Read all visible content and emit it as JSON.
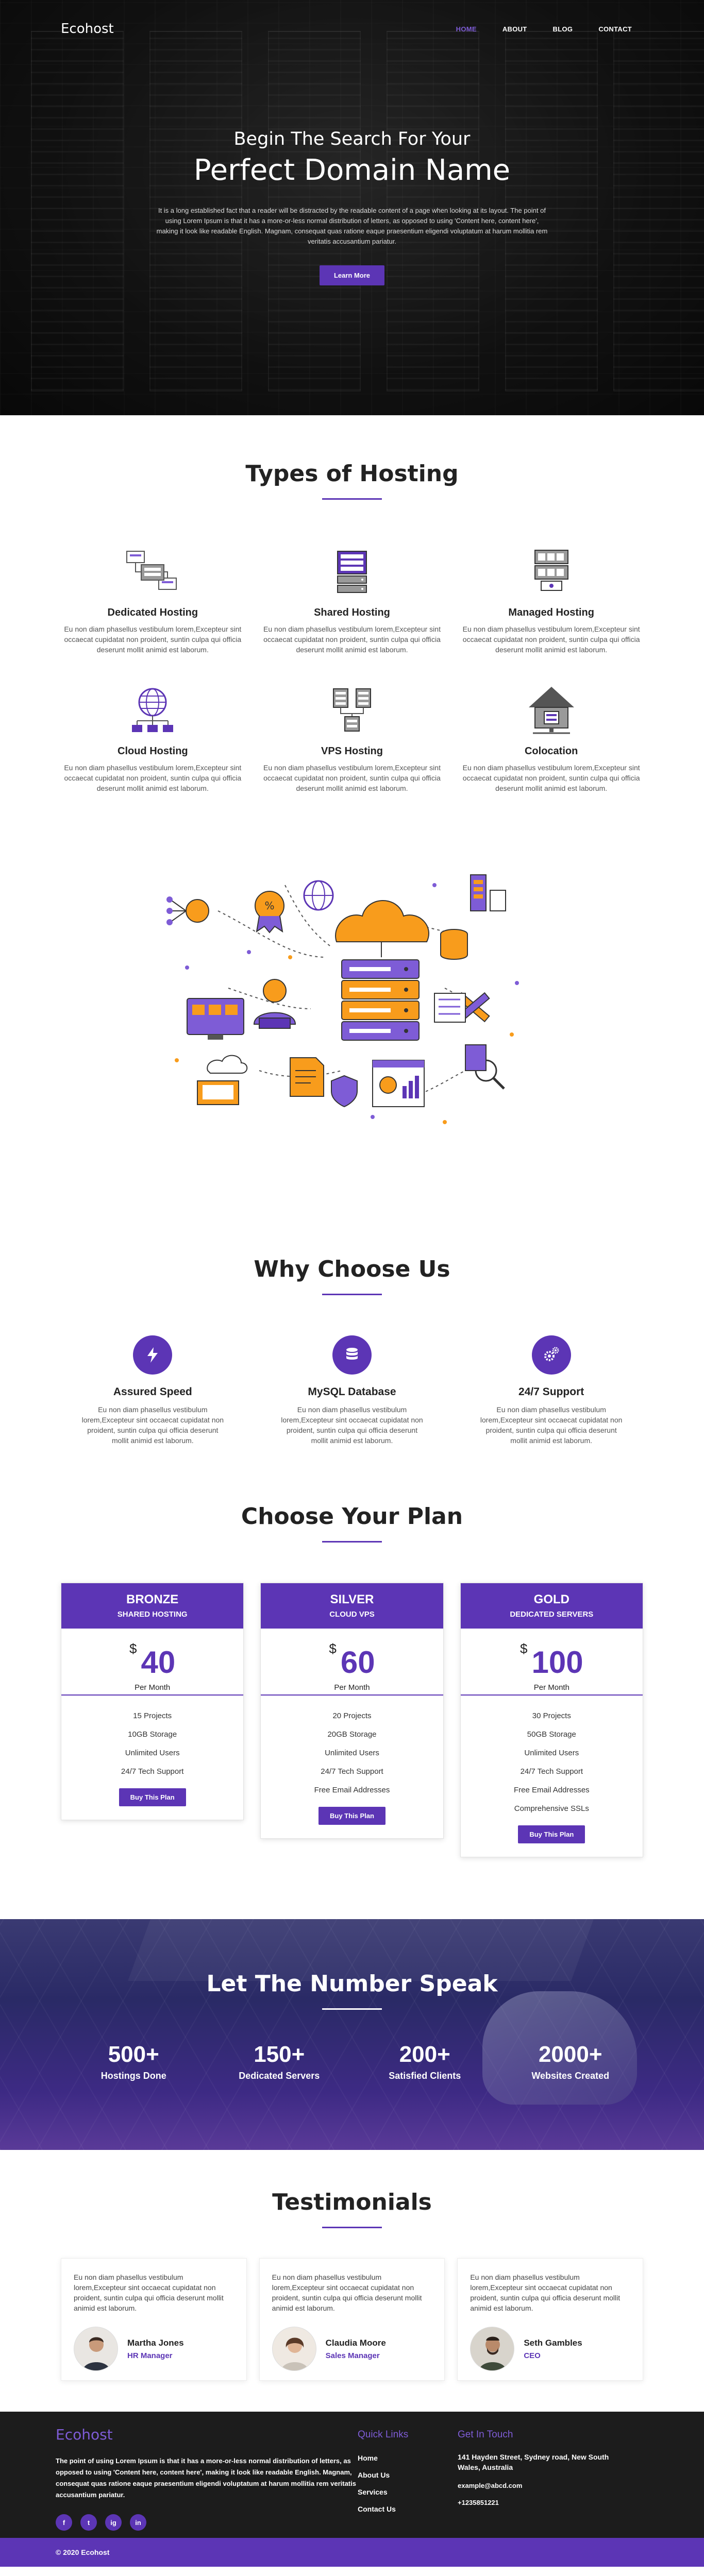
{
  "colors": {
    "accent": "#5c35b5",
    "accent_light": "#7e5cd6",
    "orange": "#f89c1c",
    "dark": "#1c1c1c"
  },
  "nav": {
    "logo": "Ecohost",
    "links": [
      "HOME",
      "ABOUT",
      "BLOG",
      "CONTACT"
    ],
    "active": "HOME"
  },
  "hero": {
    "subtitle": "Begin The Search For Your",
    "title": "Perfect Domain Name",
    "text": "It is a long established fact that a reader will be distracted by the readable content of a page when looking at its layout. The point of using Lorem Ipsum is that it has a more-or-less normal distribution of letters, as opposed to using 'Content here, content here', making it look like readable English. Magnam, consequat quas ratione eaque praesentium eligendi voluptatum at harum mollitia rem veritatis accusantium pariatur.",
    "button": "Learn More"
  },
  "hosting": {
    "title": "Types of Hosting",
    "items": [
      {
        "name": "Dedicated Hosting",
        "icon": "dedicated-server-icon",
        "desc": "Eu non diam phasellus vestibulum lorem,Excepteur sint occaecat cupidatat non proident, suntin culpa qui officia deserunt mollit animid est laborum."
      },
      {
        "name": "Shared Hosting",
        "icon": "shared-server-icon",
        "desc": "Eu non diam phasellus vestibulum lorem,Excepteur sint occaecat cupidatat non proident, suntin culpa qui officia deserunt mollit animid est laborum."
      },
      {
        "name": "Managed Hosting",
        "icon": "managed-server-icon",
        "desc": "Eu non diam phasellus vestibulum lorem,Excepteur sint occaecat cupidatat non proident, suntin culpa qui officia deserunt mollit animid est laborum."
      },
      {
        "name": "Cloud Hosting",
        "icon": "globe-network-icon",
        "desc": "Eu non diam phasellus vestibulum lorem,Excepteur sint occaecat cupidatat non proident, suntin culpa qui officia deserunt mollit animid est laborum."
      },
      {
        "name": "VPS Hosting",
        "icon": "vps-server-icon",
        "desc": "Eu non diam phasellus vestibulum lorem,Excepteur sint occaecat cupidatat non proident, suntin culpa qui officia deserunt mollit animid est laborum."
      },
      {
        "name": "Colocation",
        "icon": "house-server-icon",
        "desc": "Eu non diam phasellus vestibulum lorem,Excepteur sint occaecat cupidatat non proident, suntin culpa qui officia deserunt mollit animid est laborum."
      }
    ]
  },
  "why": {
    "title": "Why Choose Us",
    "items": [
      {
        "name": "Assured Speed",
        "icon": "lightning-icon",
        "desc": "Eu non diam phasellus vestibulum lorem,Excepteur sint occaecat cupidatat non proident, suntin culpa qui officia deserunt mollit animid est laborum."
      },
      {
        "name": "MySQL Database",
        "icon": "database-icon",
        "desc": "Eu non diam phasellus vestibulum lorem,Excepteur sint occaecat cupidatat non proident, suntin culpa qui officia deserunt mollit animid est laborum."
      },
      {
        "name": "24/7 Support",
        "icon": "gears-icon",
        "desc": "Eu non diam phasellus vestibulum lorem,Excepteur sint occaecat cupidatat non proident, suntin culpa qui officia deserunt mollit animid est laborum."
      }
    ]
  },
  "plans": {
    "title": "Choose Your Plan",
    "currency": "$",
    "per": "Per Month",
    "button": "Buy This Plan",
    "items": [
      {
        "name": "BRONZE",
        "type": "SHARED HOSTING",
        "price": "40",
        "features": [
          "15 Projects",
          "10GB Storage",
          "Unlimited Users",
          "24/7 Tech Support"
        ]
      },
      {
        "name": "SILVER",
        "type": "CLOUD VPS",
        "price": "60",
        "features": [
          "20 Projects",
          "20GB Storage",
          "Unlimited Users",
          "24/7 Tech Support",
          "Free Email Addresses"
        ]
      },
      {
        "name": "GOLD",
        "type": "DEDICATED SERVERS",
        "price": "100",
        "features": [
          "30 Projects",
          "50GB Storage",
          "Unlimited Users",
          "24/7 Tech Support",
          "Free Email Addresses",
          "Comprehensive SSLs"
        ]
      }
    ]
  },
  "numbers": {
    "title": "Let The Number Speak",
    "items": [
      {
        "value": "500+",
        "label": "Hostings Done"
      },
      {
        "value": "150+",
        "label": "Dedicated Servers"
      },
      {
        "value": "200+",
        "label": "Satisfied Clients"
      },
      {
        "value": "2000+",
        "label": "Websites Created"
      }
    ]
  },
  "testimonials": {
    "title": "Testimonials",
    "items": [
      {
        "text": "Eu non diam phasellus vestibulum lorem,Excepteur sint occaecat cupidatat non proident, suntin culpa qui officia deserunt mollit animid est laborum.",
        "name": "Martha Jones",
        "role": "HR Manager"
      },
      {
        "text": "Eu non diam phasellus vestibulum lorem,Excepteur sint occaecat cupidatat non proident, suntin culpa qui officia deserunt mollit animid est laborum.",
        "name": "Claudia Moore",
        "role": "Sales Manager"
      },
      {
        "text": "Eu non diam phasellus vestibulum lorem,Excepteur sint occaecat cupidatat non proident, suntin culpa qui officia deserunt mollit animid est laborum.",
        "name": "Seth Gambles",
        "role": "CEO"
      }
    ]
  },
  "footer": {
    "logo": "Ecohost",
    "text": "The point of using Lorem Ipsum is that it has a more-or-less normal distribution of letters, as opposed to using 'Content here, content here', making it look like readable English. Magnam, consequat quas ratione eaque praesentium eligendi voluptatum at harum mollitia rem veritatis accusantium pariatur.",
    "socials": [
      "f",
      "t",
      "ig",
      "in"
    ],
    "quick_title": "Quick Links",
    "quick_links": [
      "Home",
      "About Us",
      "Services",
      "Contact Us"
    ],
    "contact_title": "Get In Touch",
    "address": "141 Hayden Street, Sydney road, New South Wales, Australia",
    "email": "example@abcd.com",
    "phone": "+1235851221",
    "copyright": "© 2020 Ecohost"
  }
}
